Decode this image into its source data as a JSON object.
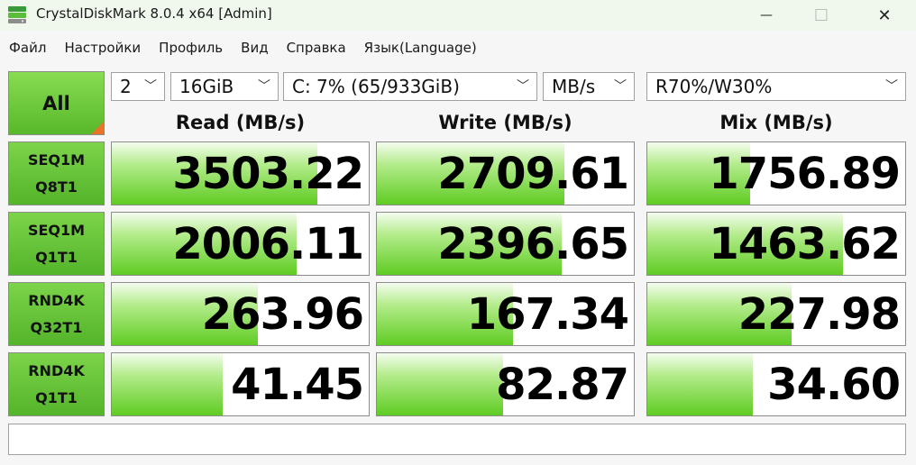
{
  "window": {
    "title": "CrystalDiskMark 8.0.4 x64 [Admin]",
    "minimize_glyph": "—",
    "maximize_glyph": "☐",
    "close_glyph": "✕"
  },
  "menu": [
    "Файл",
    "Настройки",
    "Профиль",
    "Вид",
    "Справка",
    "Язык(Language)"
  ],
  "controls": {
    "all_label": "All",
    "count": "2",
    "size": "16GiB",
    "drive": "C: 7% (65/933GiB)",
    "unit": "MB/s",
    "mix": "R70%/W30%",
    "chevron": "﹀"
  },
  "headers": {
    "read": "Read (MB/s)",
    "write": "Write (MB/s)",
    "mix": "Mix (MB/s)"
  },
  "rows": [
    {
      "line1": "SEQ1M",
      "line2": "Q8T1",
      "read": "3503.22",
      "write": "2709.61",
      "mix": "1756.89",
      "read_fill": 0.8,
      "write_fill": 0.73,
      "mix_fill": 0.4
    },
    {
      "line1": "SEQ1M",
      "line2": "Q1T1",
      "read": "2006.11",
      "write": "2396.65",
      "mix": "1463.62",
      "read_fill": 0.72,
      "write_fill": 0.72,
      "mix_fill": 0.76
    },
    {
      "line1": "RND4K",
      "line2": "Q32T1",
      "read": "263.96",
      "write": "167.34",
      "mix": "227.98",
      "read_fill": 0.57,
      "write_fill": 0.53,
      "mix_fill": 0.56
    },
    {
      "line1": "RND4K",
      "line2": "Q1T1",
      "read": "41.45",
      "write": "82.87",
      "mix": "34.60",
      "read_fill": 0.43,
      "write_fill": 0.49,
      "mix_fill": 0.41
    }
  ],
  "colors": {
    "bar_green": "#5fcc22",
    "button_green": "#6cc83a",
    "corner_orange": "#e8742a"
  },
  "status_text": ""
}
